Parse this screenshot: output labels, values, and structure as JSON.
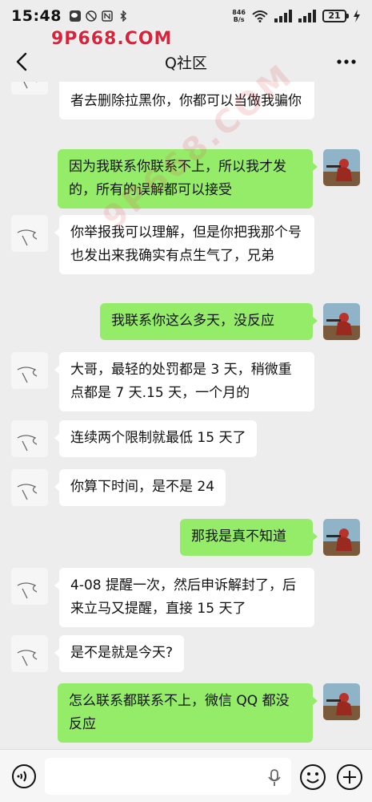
{
  "status_bar": {
    "time": "15:48",
    "net_speed_value": "846",
    "net_speed_unit": "B/s",
    "battery": "21"
  },
  "watermark": {
    "site": "9P668.COM"
  },
  "header": {
    "title": "Q社区",
    "back_icon": "chevron-left-icon",
    "more_icon": "more-dots-icon"
  },
  "messages": [
    {
      "side": "left",
      "text": "者去删除拉黑你，你都可以当做我骗你"
    },
    {
      "side": "right",
      "text": "因为我联系你联系不上，所以我才发的，所有的误解都可以接受"
    },
    {
      "side": "left",
      "text": "你举报我可以理解，但是你把我那个号也发出来我确实有点生气了，兄弟"
    },
    {
      "side": "right",
      "text": "我联系你这么多天，没反应"
    },
    {
      "side": "left",
      "text": "大哥，最轻的处罚都是 3 天，稍微重点都是 7 天.15 天，一个月的"
    },
    {
      "side": "left",
      "text": "连续两个限制就最低 15 天了"
    },
    {
      "side": "left",
      "text": "你算下时间，是不是 24"
    },
    {
      "side": "right",
      "text": "那我是真不知道"
    },
    {
      "side": "left",
      "text": "4-08 提醒一次，然后申诉解封了，后来立马又提醒，直接 15 天了"
    },
    {
      "side": "left",
      "text": "是不是就是今天?"
    },
    {
      "side": "right",
      "text": "怎么联系都联系不上，微信 QQ 都没反应"
    }
  ],
  "input_bar": {
    "text_value": "",
    "voice_icon": "voice-icon",
    "mic_icon": "microphone-icon",
    "emoji_icon": "emoji-icon",
    "plus_icon": "plus-icon"
  },
  "colors": {
    "background": "#ededed",
    "bubble_self": "#95ec69",
    "bubble_other": "#ffffff",
    "watermark": "#d8233a"
  }
}
